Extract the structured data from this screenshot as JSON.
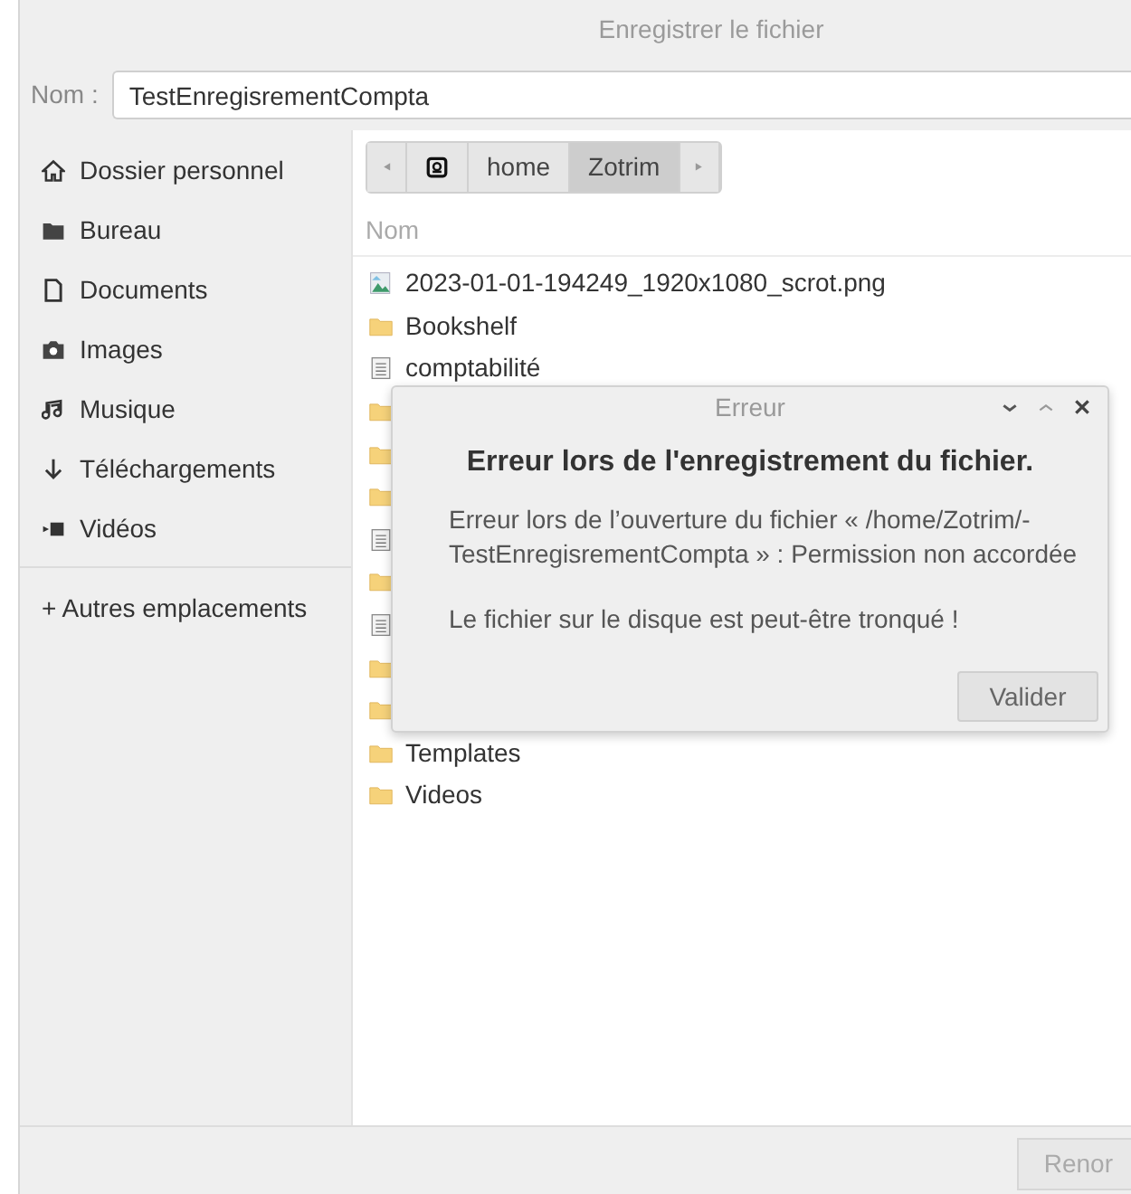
{
  "window": {
    "title": "Enregistrer le fichier"
  },
  "name_field": {
    "label": "Nom :",
    "value": "TestEnregisrementCompta"
  },
  "sidebar": {
    "items": [
      {
        "label": "Dossier personnel",
        "kind": "home"
      },
      {
        "label": "Bureau",
        "kind": "desktop"
      },
      {
        "label": "Documents",
        "kind": "documents"
      },
      {
        "label": "Images",
        "kind": "pictures"
      },
      {
        "label": "Musique",
        "kind": "music"
      },
      {
        "label": "Téléchargements",
        "kind": "downloads"
      },
      {
        "label": "Vidéos",
        "kind": "videos"
      }
    ],
    "other": {
      "label": "+ Autres emplacements"
    }
  },
  "path_bar": {
    "segments": [
      {
        "kind": "root",
        "selected": false
      },
      {
        "kind": "text",
        "label": "home",
        "selected": false
      },
      {
        "kind": "text",
        "label": "Zotrim",
        "selected": true
      }
    ]
  },
  "file_list": {
    "column": "Nom",
    "rows": [
      {
        "kind": "image",
        "name": "2023-01-01-194249_1920x1080_scrot.png"
      },
      {
        "kind": "folder",
        "name": "Bookshelf"
      },
      {
        "kind": "text",
        "name": "comptabilité"
      },
      {
        "kind": "folder"
      },
      {
        "kind": "folder"
      },
      {
        "kind": "folder"
      },
      {
        "kind": "text"
      },
      {
        "kind": "folder"
      },
      {
        "kind": "text"
      },
      {
        "kind": "folder"
      },
      {
        "kind": "folder"
      },
      {
        "kind": "folder",
        "name": "Templates"
      },
      {
        "kind": "folder",
        "name": "Videos"
      }
    ]
  },
  "dialog": {
    "title": "Erreur",
    "heading": "Erreur lors de l'enregistrement du fichier.",
    "message": [
      "Erreur lors de l’ouverture du fichier « /home/Zotrim/-",
      "TestEnregisrementCompta » : Permission non accordée"
    ],
    "note": "Le fichier sur le disque est peut-être tronqué !",
    "button": "Valider"
  },
  "footer": {
    "button": "Renor"
  }
}
